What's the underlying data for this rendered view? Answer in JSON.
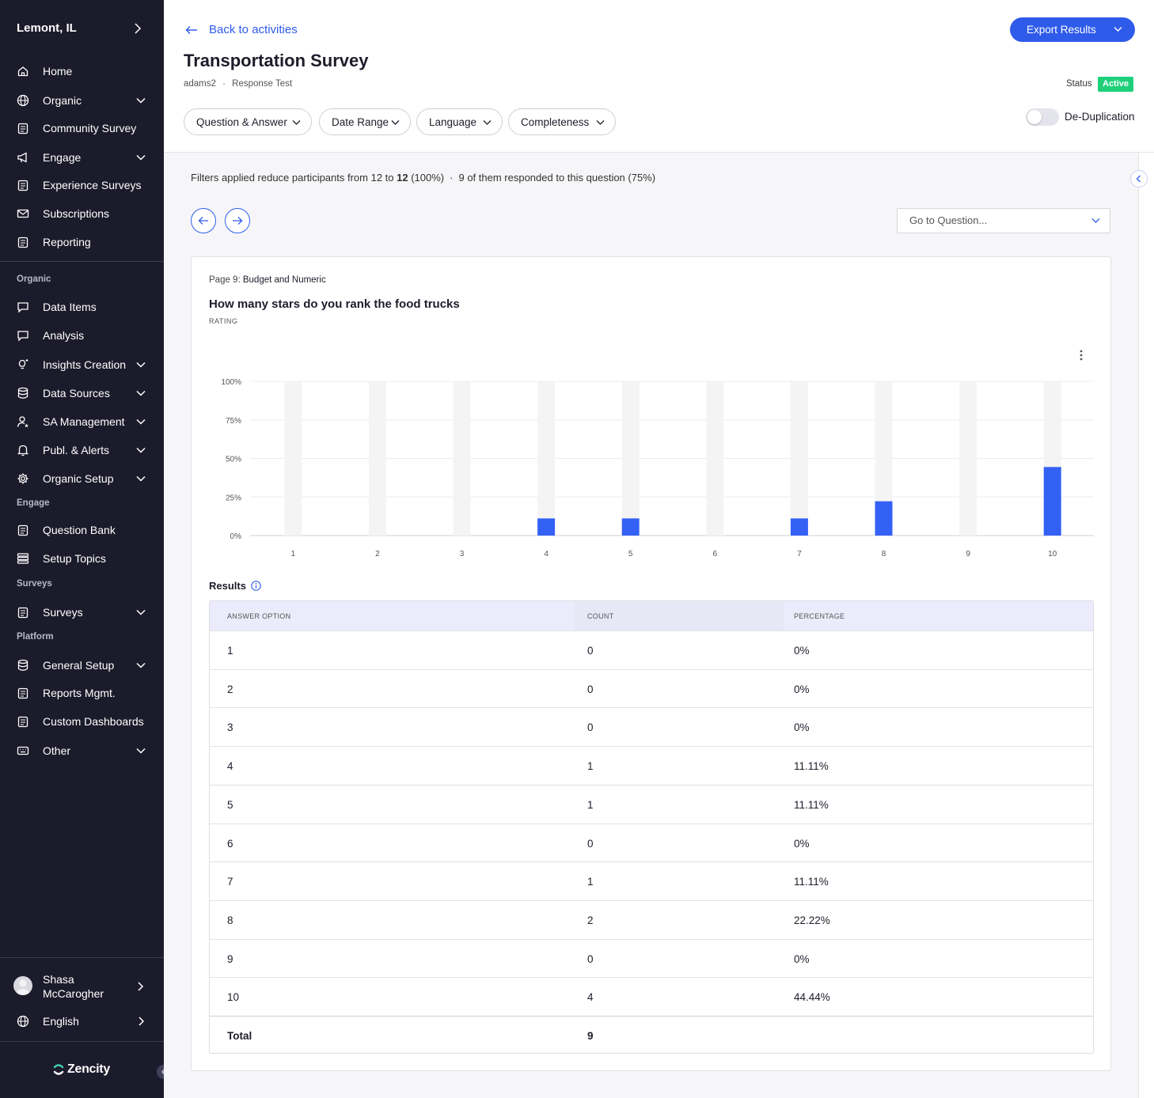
{
  "sidebar": {
    "city": "Lemont, IL",
    "main_items": [
      {
        "label": "Home",
        "icon": "home-icon",
        "expandable": false
      },
      {
        "label": "Organic",
        "icon": "globe-icon",
        "expandable": true
      },
      {
        "label": "Community Survey",
        "icon": "clipboard-icon",
        "expandable": false
      },
      {
        "label": "Engage",
        "icon": "megaphone-icon",
        "expandable": true
      },
      {
        "label": "Experience Surveys",
        "icon": "clipboard-icon",
        "expandable": false
      },
      {
        "label": "Subscriptions",
        "icon": "mail-icon",
        "expandable": false
      },
      {
        "label": "Reporting",
        "icon": "clipboard-icon",
        "expandable": false
      }
    ],
    "section_organic": "Organic",
    "organic_items": [
      {
        "label": "Data Items",
        "icon": "chat-icon",
        "expandable": false
      },
      {
        "label": "Analysis",
        "icon": "chat-icon",
        "expandable": false
      },
      {
        "label": "Insights Creation",
        "icon": "bulb-icon",
        "expandable": true
      },
      {
        "label": "Data Sources",
        "icon": "database-icon",
        "expandable": true
      },
      {
        "label": "SA Management",
        "icon": "user-star-icon",
        "expandable": true
      },
      {
        "label": "Publ. & Alerts",
        "icon": "bell-icon",
        "expandable": true
      },
      {
        "label": "Organic Setup",
        "icon": "gear-icon",
        "expandable": true
      }
    ],
    "section_engage": "Engage",
    "engage_items": [
      {
        "label": "Question Bank",
        "icon": "clipboard-icon",
        "expandable": false
      },
      {
        "label": "Setup Topics",
        "icon": "list-icon",
        "expandable": false
      }
    ],
    "section_surveys": "Surveys",
    "survey_items": [
      {
        "label": "Surveys",
        "icon": "clipboard-icon",
        "expandable": true
      }
    ],
    "section_platform": "Platform",
    "platform_items": [
      {
        "label": "General Setup",
        "icon": "database-icon",
        "expandable": true
      },
      {
        "label": "Reports Mgmt.",
        "icon": "clipboard-icon",
        "expandable": false
      },
      {
        "label": "Custom Dashboards",
        "icon": "clipboard-icon",
        "expandable": false
      },
      {
        "label": "Other",
        "icon": "keyboard-icon",
        "expandable": true
      }
    ],
    "user_name": "Shasa McCarogher",
    "language": "English",
    "brand": "Zencity"
  },
  "header": {
    "back_label": "Back to activities",
    "title": "Transportation Survey",
    "owner": "adams2",
    "subtitle": "Response Test",
    "export_label": "Export Results",
    "status_label": "Status",
    "status_value": "Active",
    "filters": [
      "Question & Answer",
      "Date Range",
      "Language",
      "Completeness"
    ],
    "dedup_label": "De-Duplication"
  },
  "content": {
    "filter_note_prefix": "Filters applied reduce participants from 12 to ",
    "filter_note_bold": "12",
    "filter_note_pct": " (100%)",
    "filter_note_suffix": "9 of them responded to this question (75%)",
    "goto_placeholder": "Go to Question...",
    "page_label": "Page 9:",
    "page_name": "Budget and Numeric",
    "question": "How many stars do you rank the food trucks",
    "question_type": "RATING",
    "results_label": "Results",
    "table": {
      "headers": [
        "ANSWER OPTION",
        "COUNT",
        "PERCENTAGE"
      ],
      "rows": [
        {
          "option": "1",
          "count": "0",
          "pct": "0%"
        },
        {
          "option": "2",
          "count": "0",
          "pct": "0%"
        },
        {
          "option": "3",
          "count": "0",
          "pct": "0%"
        },
        {
          "option": "4",
          "count": "1",
          "pct": "11.11%"
        },
        {
          "option": "5",
          "count": "1",
          "pct": "11.11%"
        },
        {
          "option": "6",
          "count": "0",
          "pct": "0%"
        },
        {
          "option": "7",
          "count": "1",
          "pct": "11.11%"
        },
        {
          "option": "8",
          "count": "2",
          "pct": "22.22%"
        },
        {
          "option": "9",
          "count": "0",
          "pct": "0%"
        },
        {
          "option": "10",
          "count": "4",
          "pct": "44.44%"
        }
      ],
      "total_label": "Total",
      "total_count": "9"
    }
  },
  "colors": {
    "sidebar_bg": "#1c1b2b",
    "accent": "#2f5bea",
    "status_active": "#1fd07a",
    "bar_track": "#f4f4f4"
  },
  "chart_data": {
    "type": "bar",
    "categories": [
      "1",
      "2",
      "3",
      "4",
      "5",
      "6",
      "7",
      "8",
      "9",
      "10"
    ],
    "values": [
      0,
      0,
      0,
      11.11,
      11.11,
      0,
      11.11,
      22.22,
      0,
      44.44
    ],
    "yticks": [
      "0%",
      "25%",
      "50%",
      "75%",
      "100%"
    ],
    "ylim": [
      0,
      100
    ],
    "grid": true
  }
}
